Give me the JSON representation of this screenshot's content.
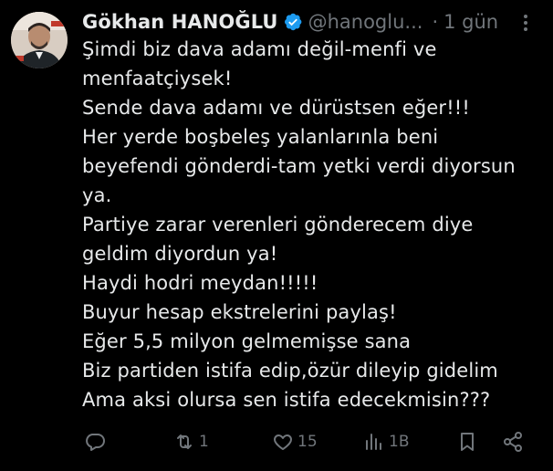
{
  "author": {
    "display_name": "Gökhan HANOĞLU",
    "handle": "@hanoglu...",
    "separator": "·",
    "time": "1 gün"
  },
  "tweet": {
    "text": "Şimdi biz dava adamı değil-menfi ve\nmenfaatçiysek!\nSende dava adamı ve dürüstsen eğer!!!\nHer yerde boşbeleş yalanlarınla beni\nbeyefendi gönderdi-tam yetki verdi diyorsun\nya.\nPartiye zarar verenleri gönderecem diye\ngeldim diyordun ya!\nHaydi hodri meydan!!!!!\nBuyur hesap ekstrelerini paylaş!\nEğer 5,5 milyon gelmemişse sana\nBiz partiden istifa edip,özür dileyip gidelim\nAma aksi olursa sen istifa edecekmisin???"
  },
  "actions": {
    "reply_icon": "reply-icon",
    "retweet_count": "1",
    "like_count": "15",
    "views_count": "1B",
    "bookmark_icon": "bookmark-icon",
    "share_icon": "share-icon"
  },
  "colors": {
    "background": "#000000",
    "text_primary": "#e7e9ea",
    "text_secondary": "#71767b",
    "verified": "#1d9bf0"
  }
}
